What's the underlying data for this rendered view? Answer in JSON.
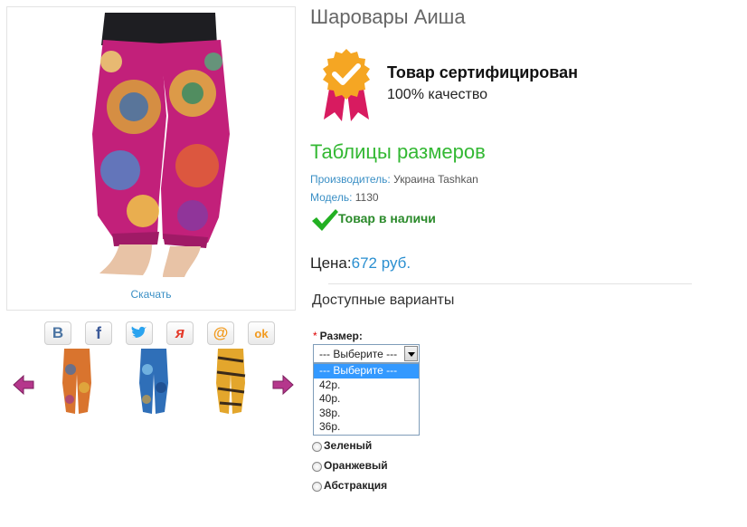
{
  "product": {
    "title": "Шаровары Аиша",
    "download_label": "Скачать"
  },
  "certificate": {
    "title": "Товар сертифицирован",
    "subtitle": "100% качество",
    "badge_color": "#f5a623",
    "ribbon_color": "#d81b60"
  },
  "size_chart_link": "Таблицы размеров",
  "manufacturer": {
    "label": "Производитель:",
    "value": "Украина Tashkan"
  },
  "model": {
    "label": "Модель:",
    "value": "1130"
  },
  "stock_status": "Товар в наличи",
  "price": {
    "label": "Цена:",
    "value": "672 руб."
  },
  "options": {
    "title": "Доступные варианты",
    "size": {
      "required_mark": "*",
      "label": "Размер:",
      "selected": "--- Выберите ---",
      "items": [
        "--- Выберите ---",
        "42р.",
        "40р.",
        "38р.",
        "36р."
      ]
    },
    "colors": [
      "Зеленый",
      "Оранжевый",
      "Абстракция"
    ]
  },
  "social": [
    {
      "name": "vkontakte-icon",
      "glyph": "В",
      "color": "#4c75a3"
    },
    {
      "name": "facebook-icon",
      "glyph": "f",
      "color": "#3b5998"
    },
    {
      "name": "twitter-icon",
      "glyph": "",
      "color": "#2aa3ef"
    },
    {
      "name": "moikrug-icon",
      "glyph": "я",
      "color": "#e53a2a"
    },
    {
      "name": "mail-ru-icon",
      "glyph": "@",
      "color": "#f29a1d"
    },
    {
      "name": "odnoklassniki-icon",
      "glyph": "ok",
      "color": "#f29a1d"
    }
  ],
  "colors": {
    "accent_green": "#33b833",
    "link_blue": "#3a8fc5",
    "arrow": "#b5378c"
  }
}
